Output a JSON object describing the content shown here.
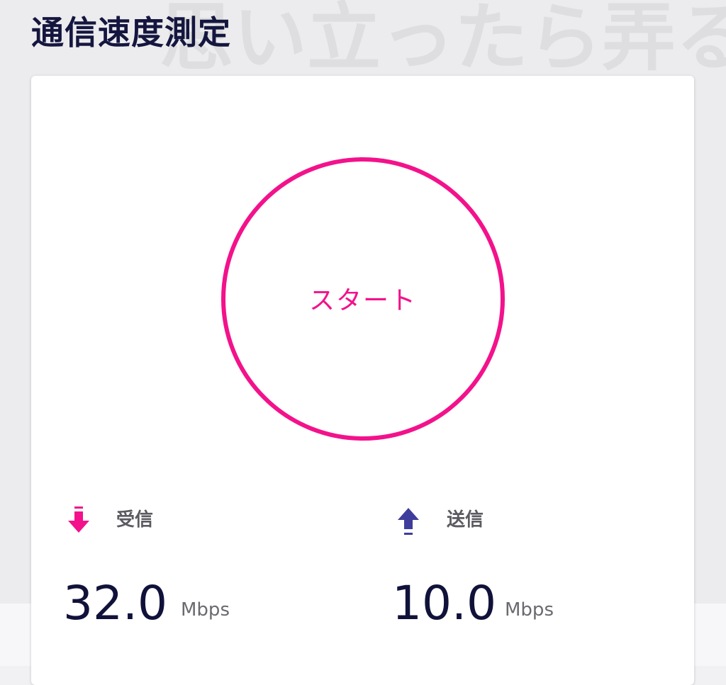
{
  "header": {
    "title": "通信速度測定",
    "watermark": "思い立ったら弄る！"
  },
  "speed_test": {
    "start_label": "スタート"
  },
  "download": {
    "icon": "download-arrow-icon",
    "label": "受信",
    "value": "32.0",
    "unit": "Mbps"
  },
  "upload": {
    "icon": "upload-arrow-icon",
    "label": "送信",
    "value": "10.0",
    "unit": "Mbps"
  },
  "colors": {
    "accent": "#f3128b",
    "upload_accent": "#3f3d9c",
    "title": "#15163f",
    "value": "#10123a"
  }
}
